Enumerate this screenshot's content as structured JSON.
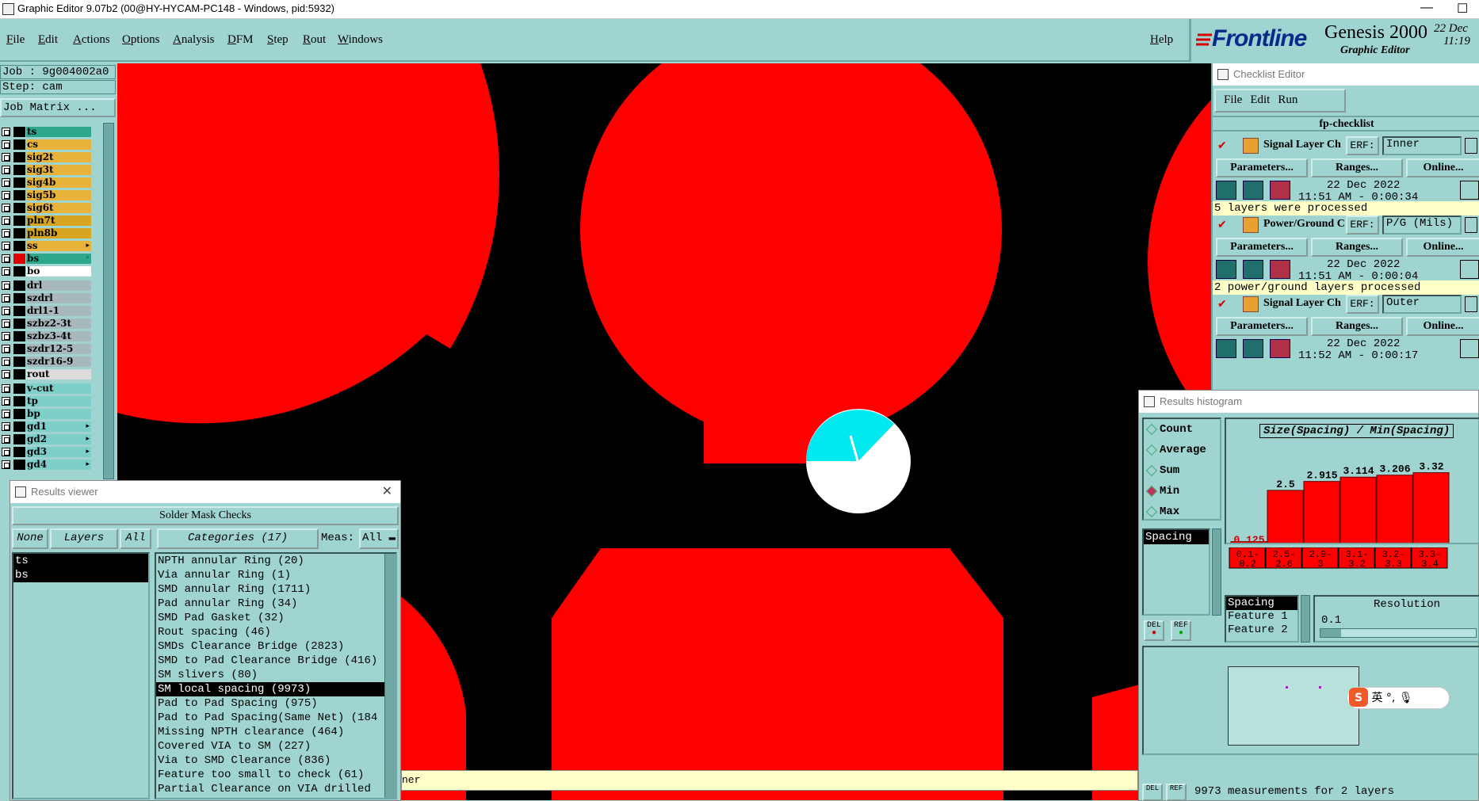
{
  "titlebar": {
    "title": "Graphic Editor 9.07b2 (00@HY-HYCAM-PC148 - Windows, pid:5932)",
    "minimize": "—",
    "maximize": "☐"
  },
  "menubar": {
    "items": [
      "File",
      "Edit",
      "Actions",
      "Options",
      "Analysis",
      "DFM",
      "Step",
      "Rout",
      "Windows"
    ],
    "help": "Help"
  },
  "brand": {
    "logo": "Frontline",
    "product": "Genesis 2000",
    "subtitle": "Graphic Editor",
    "date": "22 Dec",
    "time": "11:19"
  },
  "left_panel": {
    "job": "Job : 9g004002a0",
    "step": "Step: cam",
    "matrix_button": "Job Matrix ...",
    "layers": [
      {
        "name": "ts",
        "color": "#2ea88a"
      },
      {
        "name": "cs",
        "color": "#e8b33a"
      },
      {
        "name": "sig2t",
        "color": "#e8b33a"
      },
      {
        "name": "sig3t",
        "color": "#e8b33a"
      },
      {
        "name": "sig4b",
        "color": "#e8b33a"
      },
      {
        "name": "sig5b",
        "color": "#e8b33a"
      },
      {
        "name": "sig6t",
        "color": "#e8b33a"
      },
      {
        "name": "pln7t",
        "color": "#d9a520"
      },
      {
        "name": "pln8b",
        "color": "#d9a520"
      },
      {
        "name": "ss",
        "color": "#e8b33a",
        "mark": "▸"
      },
      {
        "name": "bs",
        "color": "#2ea88a",
        "mark": "◦",
        "active": true
      },
      {
        "name": "bo",
        "color": "#ffffff"
      },
      {
        "name": "drl",
        "color": "#a8b8bd"
      },
      {
        "name": "szdrl",
        "color": "#a8b8bd"
      },
      {
        "name": "drl1-1",
        "color": "#a8b8bd"
      },
      {
        "name": "szbz2-3t",
        "color": "#a8b8bd"
      },
      {
        "name": "szbz3-4t",
        "color": "#a8b8bd"
      },
      {
        "name": "szdr12-5",
        "color": "#a8b8bd"
      },
      {
        "name": "szdr16-9",
        "color": "#a8b8bd"
      },
      {
        "name": "rout",
        "color": "#dcdcdc"
      },
      {
        "name": "v-cut",
        "color": "#7ecfc9"
      },
      {
        "name": "tp",
        "color": "#7ecfc9"
      },
      {
        "name": "bp",
        "color": "#7ecfc9"
      },
      {
        "name": "gd1",
        "color": "#7ecfc9",
        "mark": "▸"
      },
      {
        "name": "gd2",
        "color": "#7ecfc9",
        "mark": "▸"
      },
      {
        "name": "gd3",
        "color": "#7ecfc9",
        "mark": "▸"
      },
      {
        "name": "gd4",
        "color": "#7ecfc9",
        "mark": "▸"
      }
    ]
  },
  "results_viewer": {
    "title": "Results viewer",
    "close": "✕",
    "header": "Solder Mask Checks",
    "none_btn": "None",
    "layers_btn": "Layers",
    "all_btn": "All",
    "categories_btn": "Categories (17)",
    "meas_label": "Meas:",
    "meas_value": "All",
    "layers": [
      "ts",
      "bs"
    ],
    "categories": [
      "NPTH annular Ring (20)",
      "Via annular Ring (1)",
      "SMD annular Ring (1711)",
      "Pad annular Ring (34)",
      "SMD Pad Gasket (32)",
      "Rout spacing (46)",
      "SMDs Clearance Bridge (2823)",
      "SMD to Pad Clearance Bridge (416)",
      "SM slivers (80)",
      "SM local spacing (9973)",
      "Pad to Pad Spacing (975)",
      "Pad to Pad Spacing(Same Net) (184",
      "Missing NPTH clearance (464)",
      "Covered VIA to SM (227)",
      "Via to SMD Clearance (836)",
      "Feature too small to check (61)",
      "Partial Clearance on VIA drilled"
    ],
    "selected_category": 9
  },
  "checklist_editor": {
    "title": "Checklist Editor",
    "menu": [
      "File",
      "Edit",
      "Run"
    ],
    "checklist_name": "fp-checklist",
    "erf_label": "ERF:",
    "params_btn": "Parameters...",
    "ranges_btn": "Ranges...",
    "online_btn": "Online...",
    "checks": [
      {
        "name": "Signal Layer Ch",
        "erf": "Inner",
        "date": "22 Dec 2022",
        "time": "11:51 AM - 0:00:34",
        "status": "5 layers were processed"
      },
      {
        "name": "Power/Ground C",
        "erf": "P/G (Mils)",
        "date": "22 Dec 2022",
        "time": "11:51 AM - 0:00:04",
        "status": "2 power/ground layers processed"
      },
      {
        "name": "Signal Layer Ch",
        "erf": "Outer",
        "date": "22 Dec 2022",
        "time": "11:52 AM - 0:00:17",
        "status": ""
      }
    ]
  },
  "results_histogram": {
    "title": "Results histogram",
    "options": [
      "Count",
      "Average",
      "Sum",
      "Min",
      "Max"
    ],
    "selected_option": "Min",
    "measure_list": [
      "Spacing"
    ],
    "chart_title": "Size(Spacing) / Min(Spacing)",
    "del_label": "DEL",
    "ref_label": "REF",
    "detail_list": [
      "Spacing",
      "Feature 1",
      "Feature 2"
    ],
    "resolution_label": "Resolution",
    "resolution_value": "0.1",
    "status": "9973 measurements for 2 layers"
  },
  "chart_data": {
    "type": "bar",
    "title": "Size(Spacing) / Min(Spacing)",
    "categories": [
      "0.1-0.2",
      "2.5-2.6",
      "2.9-3",
      "3.1-3.2",
      "3.2-3.3",
      "3.3-3.4"
    ],
    "values": [
      0.125,
      2.5,
      2.915,
      3.114,
      3.206,
      3.32
    ],
    "value_labels": [
      "0.125",
      "2.5",
      "2.915",
      "3.114",
      "3.206",
      "3.32"
    ],
    "bar_color": "#ff0000"
  },
  "status_bar": {
    "text": "ner"
  },
  "ime": {
    "label": "英"
  }
}
